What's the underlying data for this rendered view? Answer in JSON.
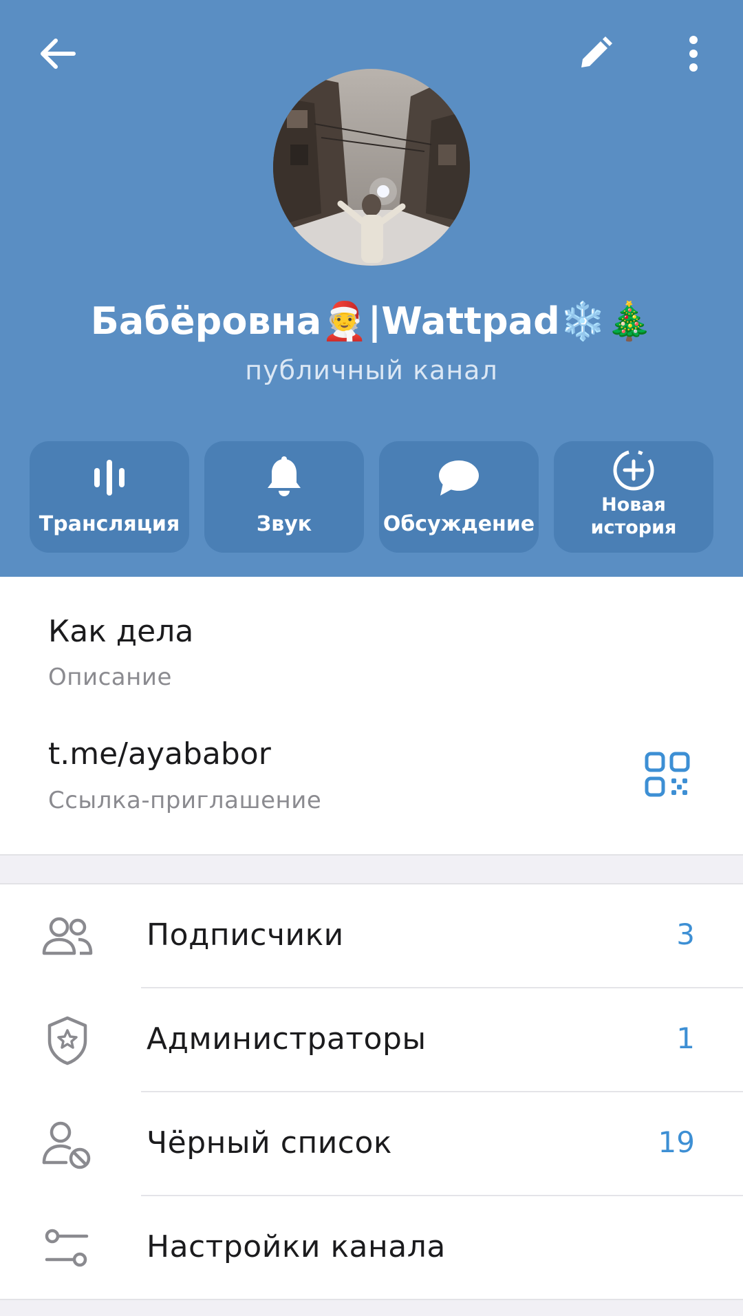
{
  "header": {
    "channel_name": "Бабёровна🧑‍🎄|Wattpad❄️🎄",
    "channel_type": "публичный канал"
  },
  "actions": [
    {
      "label": "Трансляция",
      "icon": "live-stream-icon"
    },
    {
      "label": "Звук",
      "icon": "bell-icon"
    },
    {
      "label": "Обсуждение",
      "icon": "chat-bubble-icon"
    },
    {
      "label": "Новая история",
      "line1": "Новая",
      "line2": "история",
      "icon": "add-story-icon"
    }
  ],
  "info": {
    "description_value": "Как дела",
    "description_label": "Описание",
    "link_value": "t.me/ayababor",
    "link_label": "Ссылка-приглашение"
  },
  "menu": [
    {
      "label": "Подписчики",
      "count": "3",
      "icon": "subscribers-icon"
    },
    {
      "label": "Администраторы",
      "count": "1",
      "icon": "admin-shield-icon"
    },
    {
      "label": "Чёрный список",
      "count": "19",
      "icon": "blocked-user-icon"
    },
    {
      "label": "Настройки канала",
      "count": "",
      "icon": "settings-sliders-icon"
    }
  ],
  "colors": {
    "header_bg": "#5a8ec3",
    "action_bg": "#4a7fb5",
    "accent": "#3d8fd4",
    "icon_gray": "#8a8a8f"
  }
}
